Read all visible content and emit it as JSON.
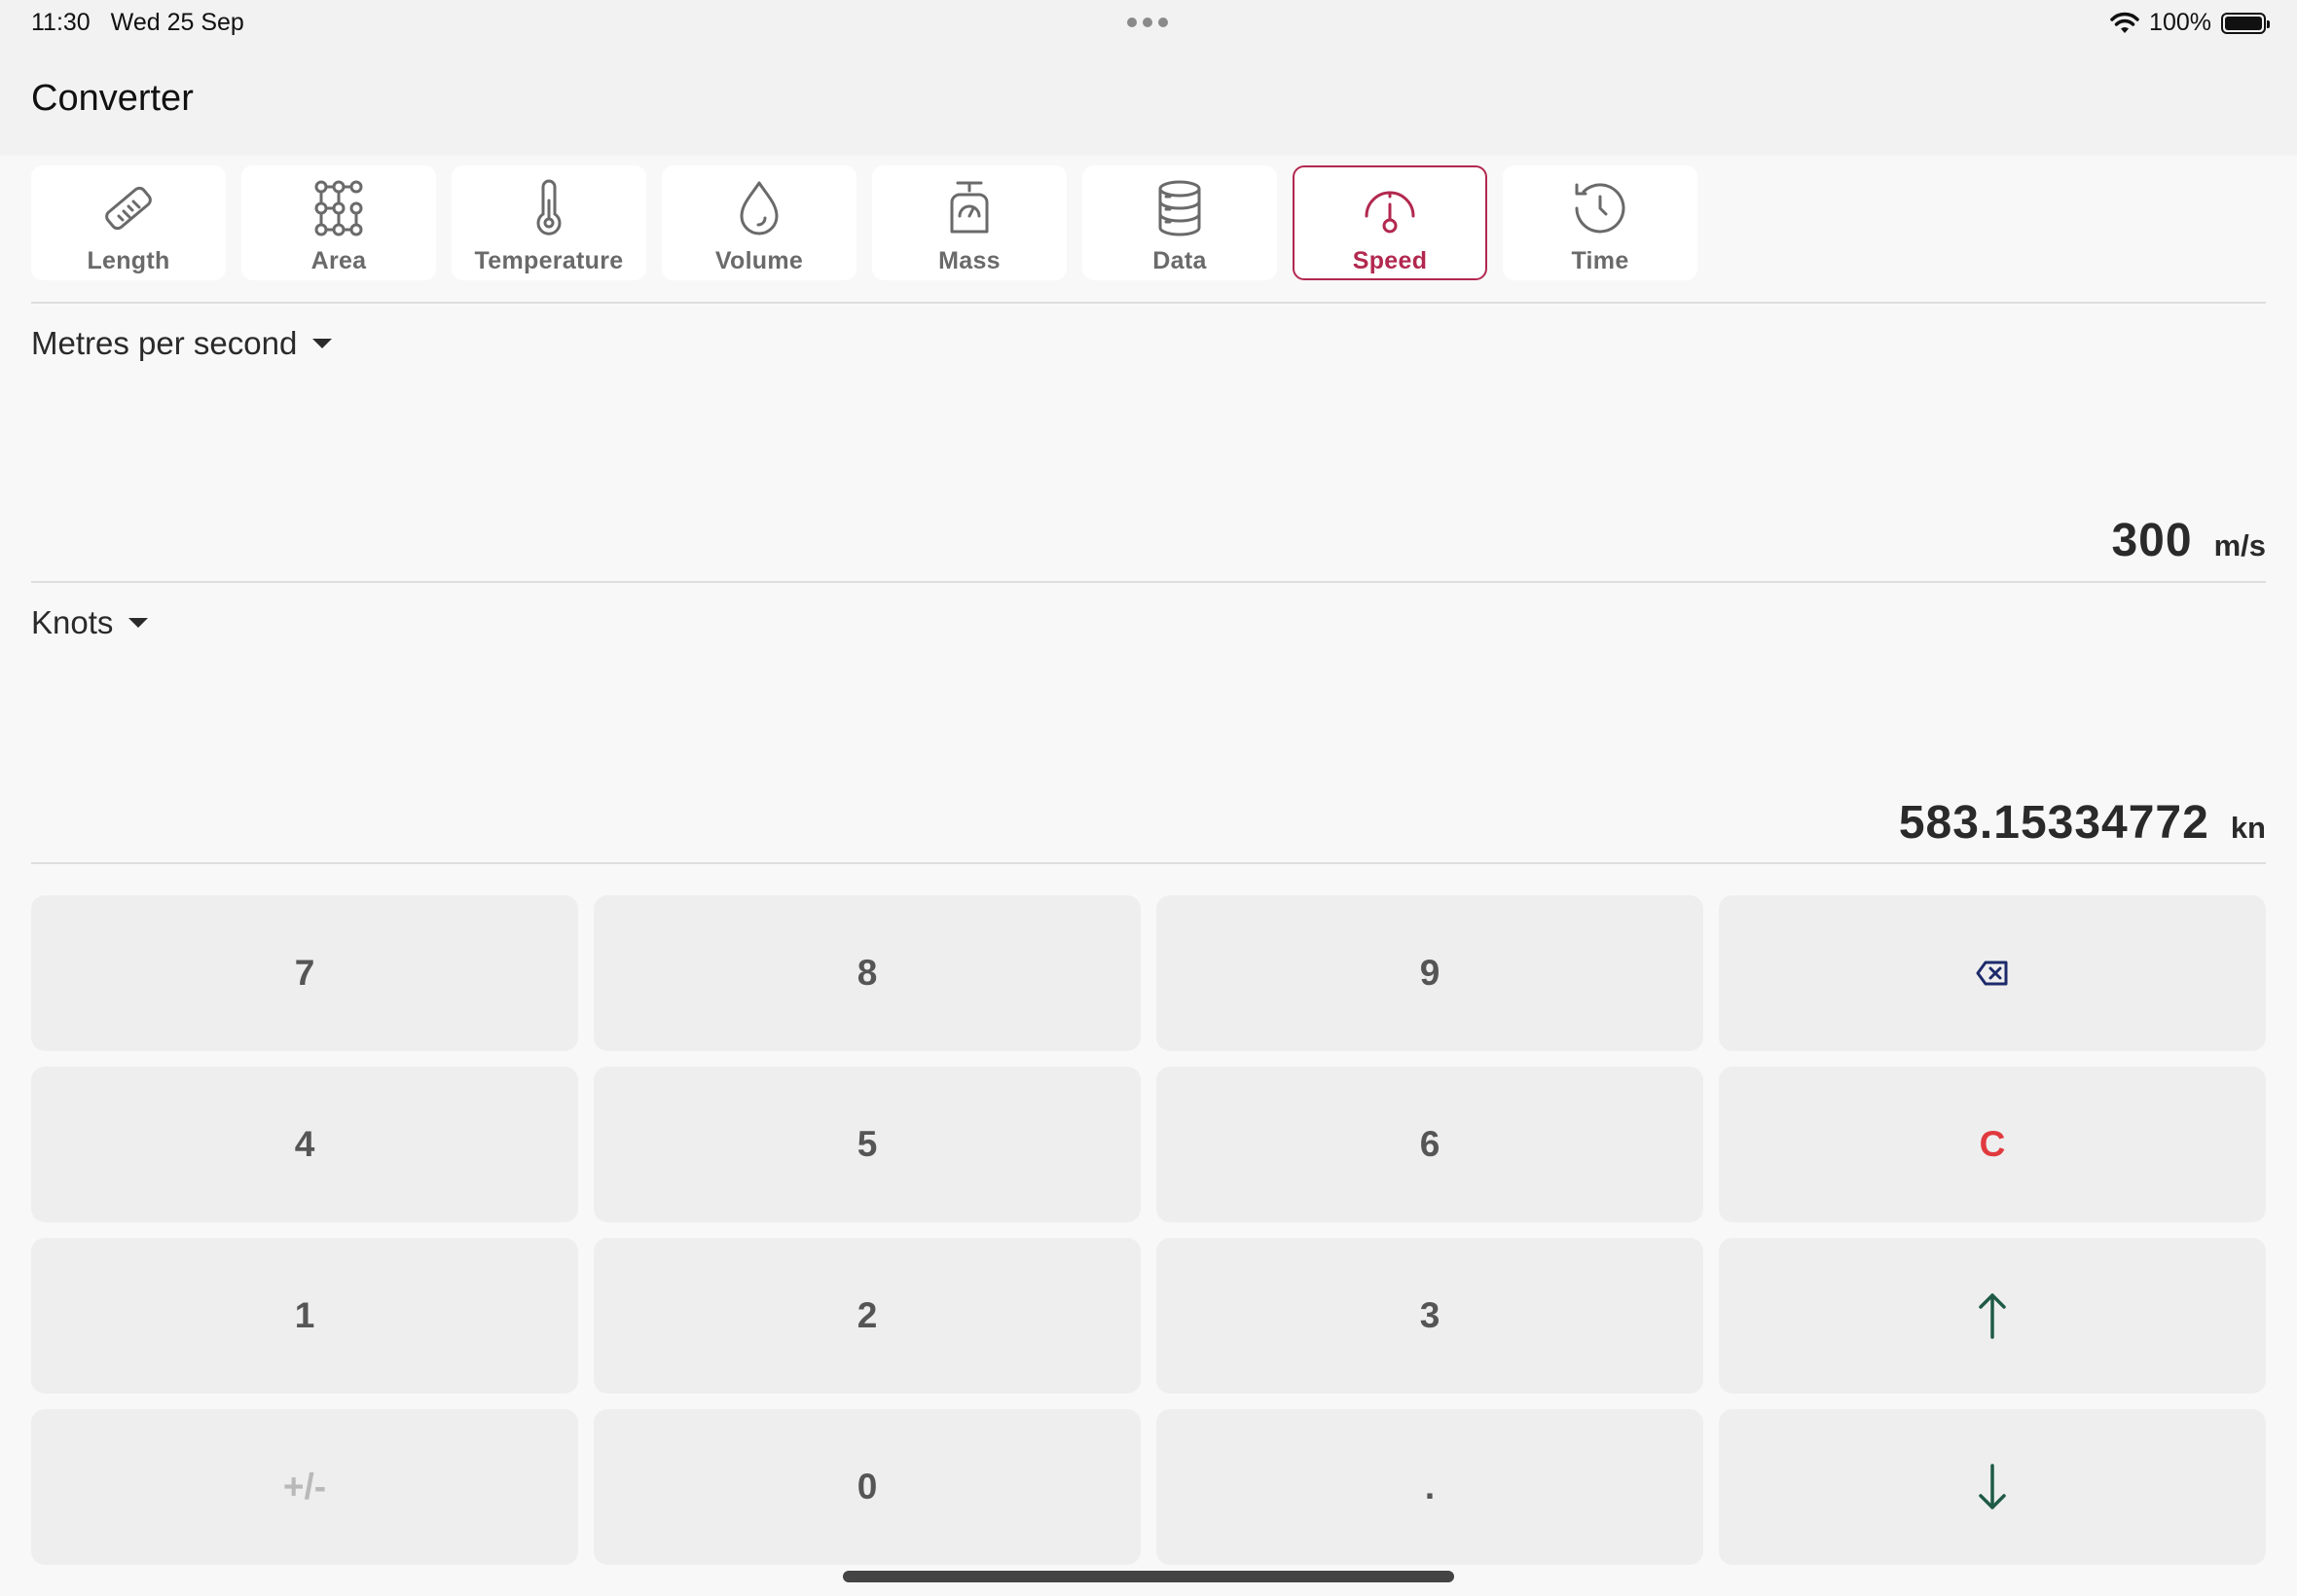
{
  "status_bar": {
    "time": "11:30",
    "date": "Wed 25 Sep",
    "battery": "100%"
  },
  "header": {
    "title": "Converter"
  },
  "tabs": [
    {
      "label": "Length",
      "icon": "ruler-icon",
      "active": false
    },
    {
      "label": "Area",
      "icon": "area-grid-icon",
      "active": false
    },
    {
      "label": "Temperature",
      "icon": "thermometer-icon",
      "active": false
    },
    {
      "label": "Volume",
      "icon": "droplet-icon",
      "active": false
    },
    {
      "label": "Mass",
      "icon": "scale-icon",
      "active": false
    },
    {
      "label": "Data",
      "icon": "database-icon",
      "active": false
    },
    {
      "label": "Speed",
      "icon": "speedometer-icon",
      "active": true
    },
    {
      "label": "Time",
      "icon": "clock-icon",
      "active": false
    }
  ],
  "from": {
    "unit_name": "Metres per second",
    "value": "300",
    "unit_symbol": "m/s"
  },
  "to": {
    "unit_name": "Knots",
    "value": "583.15334772",
    "unit_symbol": "kn"
  },
  "keypad": {
    "k7": "7",
    "k8": "8",
    "k9": "9",
    "k4": "4",
    "k5": "5",
    "k6": "6",
    "clear": "C",
    "k1": "1",
    "k2": "2",
    "k3": "3",
    "sign": "+/-",
    "k0": "0",
    "decimal": "."
  },
  "colors": {
    "accent": "#b2284f",
    "clear": "#e0393e",
    "arrows": "#1e5a46",
    "backspace": "#1c2a6b"
  }
}
